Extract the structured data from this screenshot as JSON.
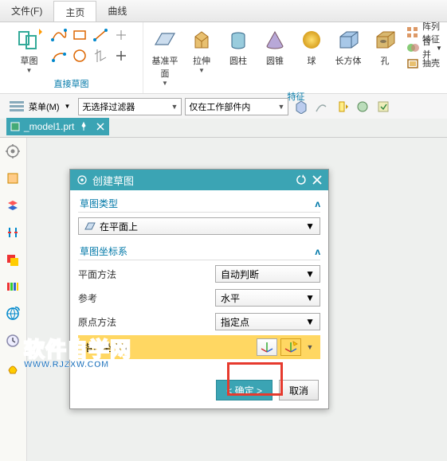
{
  "menubar": {
    "file": "文件(F)",
    "home": "主页",
    "curve": "曲线"
  },
  "ribbon": {
    "sketch_group": "直接草图",
    "sketch_label": "草图",
    "datum_plane": "基准平面",
    "extrude": "拉伸",
    "cylinder": "圆柱",
    "cone": "圆锥",
    "sphere": "球",
    "cuboid": "长方体",
    "hole": "孔",
    "feature_group": "特征",
    "pattern": "阵列特征",
    "merge": "合并",
    "shell": "抽壳"
  },
  "filterbar": {
    "menu": "菜单(M)",
    "filter": "无选择过滤器",
    "scope": "仅在工作部件内"
  },
  "filetab": {
    "name": "_model1.prt"
  },
  "dialog": {
    "title": "创建草图",
    "section_type": "草图类型",
    "type_value": "在平面上",
    "section_csys": "草图坐标系",
    "plane_method": "平面方法",
    "plane_method_value": "自动判断",
    "reference": "参考",
    "reference_value": "水平",
    "origin_method": "原点方法",
    "origin_method_value": "指定点",
    "specify_csys": "指定坐标系",
    "ok": "< 确定 >",
    "cancel": "取消"
  },
  "watermark": {
    "big": "软件自学网",
    "url": "WWW.RJZXW.COM"
  }
}
